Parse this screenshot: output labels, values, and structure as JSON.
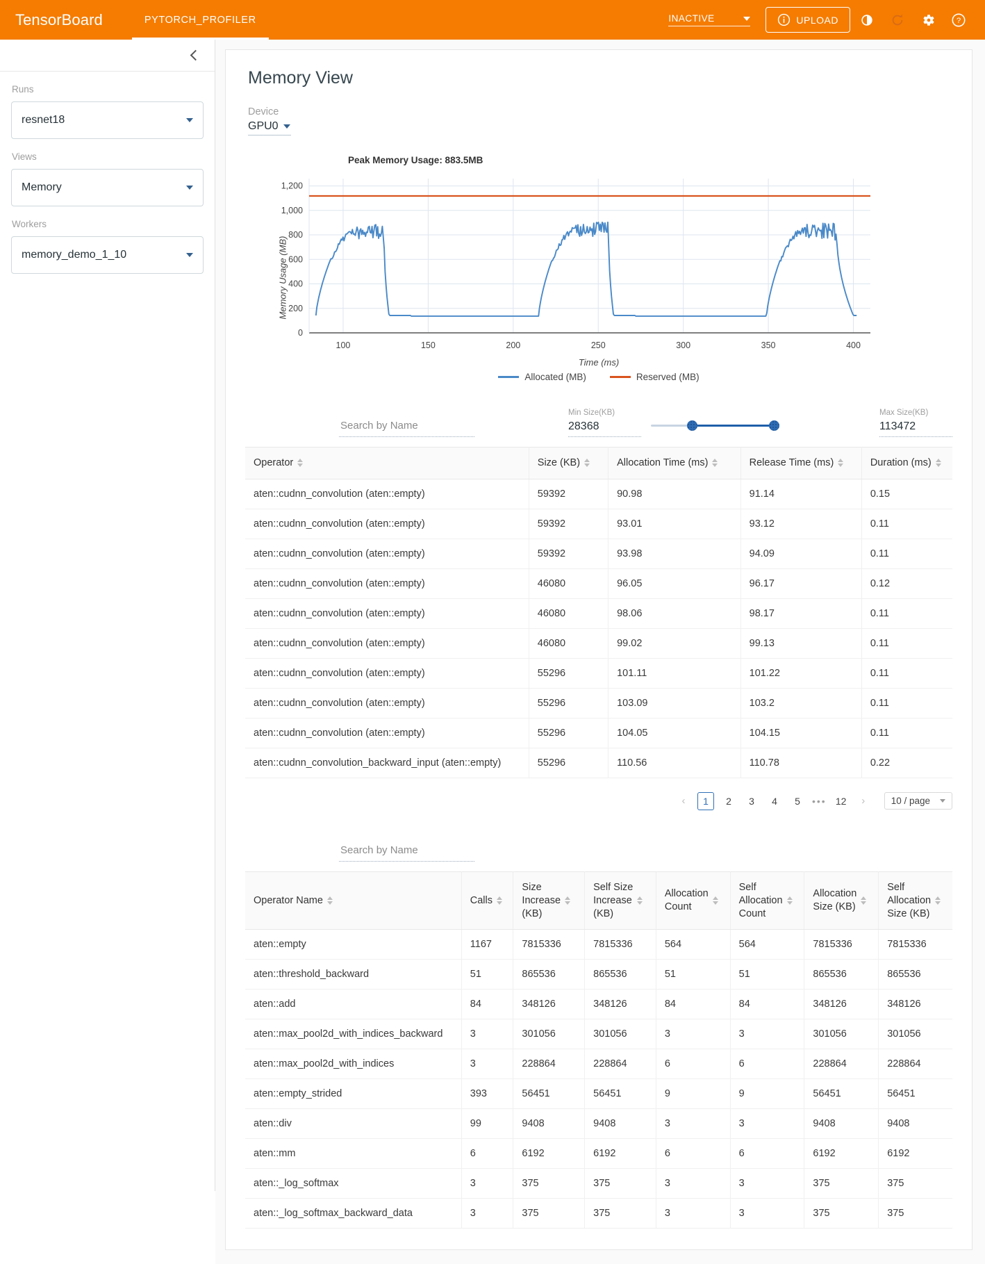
{
  "topbar": {
    "brand": "TensorBoard",
    "tabs": [
      {
        "label": "PYTORCH_PROFILER",
        "active": true
      }
    ],
    "run_status": "INACTIVE",
    "upload_label": "UPLOAD",
    "icons": [
      "info-icon",
      "brightness-icon",
      "refresh-icon",
      "gear-icon",
      "help-icon"
    ]
  },
  "sidebar": {
    "collapse_icon": "chevron-left-icon",
    "groups": [
      {
        "label": "Runs",
        "value": "resnet18"
      },
      {
        "label": "Views",
        "value": "Memory"
      },
      {
        "label": "Workers",
        "value": "memory_demo_1_10"
      }
    ]
  },
  "main": {
    "title": "Memory View",
    "device_label": "Device",
    "device_value": "GPU0"
  },
  "chart_data": {
    "type": "line",
    "title": "Peak Memory Usage: 883.5MB",
    "xlabel": "Time (ms)",
    "ylabel": "Memory Usage (MB)",
    "xlim": [
      80,
      410
    ],
    "ylim": [
      0,
      1260
    ],
    "xticks": [
      100,
      150,
      200,
      250,
      300,
      350,
      400
    ],
    "yticks": [
      0,
      200,
      400,
      600,
      800,
      1000,
      1200
    ],
    "grid": true,
    "legend_position": "bottom",
    "peak_value": 883.5,
    "reserved_level": 1118,
    "series": [
      {
        "name": "Allocated (MB)",
        "color": "#4a89c8",
        "baseline": 142,
        "cycles": [
          {
            "rise_start": 84,
            "rise_end": 108,
            "plateau_end": 124,
            "fall_end": 127,
            "peak": 860
          },
          {
            "rise_start": 215,
            "rise_end": 238,
            "plateau_end": 256,
            "fall_end": 259,
            "peak": 880
          },
          {
            "rise_start": 349,
            "rise_end": 372,
            "plateau_end": 390,
            "fall_end": 400,
            "peak": 870
          }
        ]
      },
      {
        "name": "Reserved (MB)",
        "color": "#d9541e",
        "constant": 1118
      }
    ]
  },
  "filters": {
    "search_placeholder": "Search by Name",
    "min_label": "Min Size(KB)",
    "min_value": "28368",
    "max_label": "Max Size(KB)",
    "max_value": "113472"
  },
  "table_ops": {
    "columns": [
      "Operator",
      "Size (KB)",
      "Allocation Time (ms)",
      "Release Time (ms)",
      "Duration (ms)"
    ],
    "rows": [
      [
        "aten::cudnn_convolution (aten::empty)",
        "59392",
        "90.98",
        "91.14",
        "0.15"
      ],
      [
        "aten::cudnn_convolution (aten::empty)",
        "59392",
        "93.01",
        "93.12",
        "0.11"
      ],
      [
        "aten::cudnn_convolution (aten::empty)",
        "59392",
        "93.98",
        "94.09",
        "0.11"
      ],
      [
        "aten::cudnn_convolution (aten::empty)",
        "46080",
        "96.05",
        "96.17",
        "0.12"
      ],
      [
        "aten::cudnn_convolution (aten::empty)",
        "46080",
        "98.06",
        "98.17",
        "0.11"
      ],
      [
        "aten::cudnn_convolution (aten::empty)",
        "46080",
        "99.02",
        "99.13",
        "0.11"
      ],
      [
        "aten::cudnn_convolution (aten::empty)",
        "55296",
        "101.11",
        "101.22",
        "0.11"
      ],
      [
        "aten::cudnn_convolution (aten::empty)",
        "55296",
        "103.09",
        "103.2",
        "0.11"
      ],
      [
        "aten::cudnn_convolution (aten::empty)",
        "55296",
        "104.05",
        "104.15",
        "0.11"
      ],
      [
        "aten::cudnn_convolution_backward_input (aten::empty)",
        "55296",
        "110.56",
        "110.78",
        "0.22"
      ]
    ],
    "pagination": {
      "prev_icon": "chevron-left-icon",
      "next_icon": "chevron-right-icon",
      "pages": [
        "1",
        "2",
        "3",
        "4",
        "5"
      ],
      "ellipsis": "•••",
      "last_page": "12",
      "active_page": "1",
      "page_size": "10 / page"
    }
  },
  "table_summary": {
    "search_placeholder": "Search by Name",
    "columns": [
      "Operator Name",
      "Calls",
      "Size\nIncrease\n(KB)",
      "Self Size\nIncrease\n(KB)",
      "Allocation\nCount",
      "Self\nAllocation\nCount",
      "Allocation\nSize (KB)",
      "Self\nAllocation\nSize (KB)"
    ],
    "rows": [
      [
        "aten::empty",
        "1167",
        "7815336",
        "7815336",
        "564",
        "564",
        "7815336",
        "7815336"
      ],
      [
        "aten::threshold_backward",
        "51",
        "865536",
        "865536",
        "51",
        "51",
        "865536",
        "865536"
      ],
      [
        "aten::add",
        "84",
        "348126",
        "348126",
        "84",
        "84",
        "348126",
        "348126"
      ],
      [
        "aten::max_pool2d_with_indices_backward",
        "3",
        "301056",
        "301056",
        "3",
        "3",
        "301056",
        "301056"
      ],
      [
        "aten::max_pool2d_with_indices",
        "3",
        "228864",
        "228864",
        "6",
        "6",
        "228864",
        "228864"
      ],
      [
        "aten::empty_strided",
        "393",
        "56451",
        "56451",
        "9",
        "9",
        "56451",
        "56451"
      ],
      [
        "aten::div",
        "99",
        "9408",
        "9408",
        "3",
        "3",
        "9408",
        "9408"
      ],
      [
        "aten::mm",
        "6",
        "6192",
        "6192",
        "6",
        "6",
        "6192",
        "6192"
      ],
      [
        "aten::_log_softmax",
        "3",
        "375",
        "375",
        "3",
        "3",
        "375",
        "375"
      ],
      [
        "aten::_log_softmax_backward_data",
        "3",
        "375",
        "375",
        "3",
        "3",
        "375",
        "375"
      ]
    ]
  }
}
